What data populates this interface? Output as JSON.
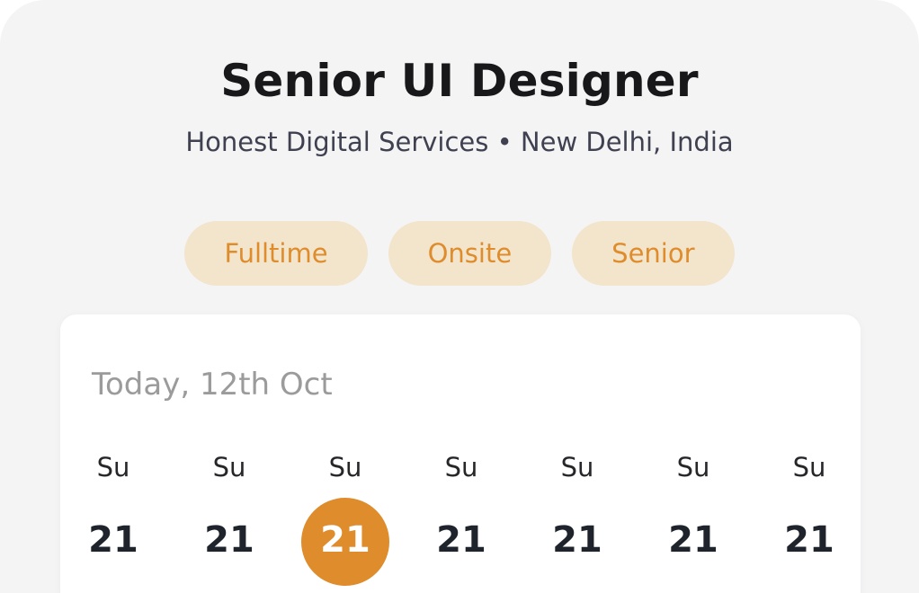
{
  "job": {
    "title": "Senior UI Designer",
    "subtitle": "Honest Digital Services • New Delhi, India"
  },
  "tags": [
    {
      "label": "Fulltime"
    },
    {
      "label": "Onsite"
    },
    {
      "label": "Senior"
    }
  ],
  "calendar": {
    "today_label": "Today, 12th Oct",
    "days": [
      {
        "weekday": "Su",
        "date": "21",
        "selected": false
      },
      {
        "weekday": "Su",
        "date": "21",
        "selected": false
      },
      {
        "weekday": "Su",
        "date": "21",
        "selected": true
      },
      {
        "weekday": "Su",
        "date": "21",
        "selected": false
      },
      {
        "weekday": "Su",
        "date": "21",
        "selected": false
      },
      {
        "weekday": "Su",
        "date": "21",
        "selected": false
      },
      {
        "weekday": "Su",
        "date": "21",
        "selected": false
      }
    ]
  },
  "colors": {
    "accent": "#de8c2c",
    "tag_background": "#f3e4cc",
    "background": "#f4f4f5",
    "card": "#ffffff",
    "title": "#18181b",
    "muted": "#9b9b9b"
  }
}
